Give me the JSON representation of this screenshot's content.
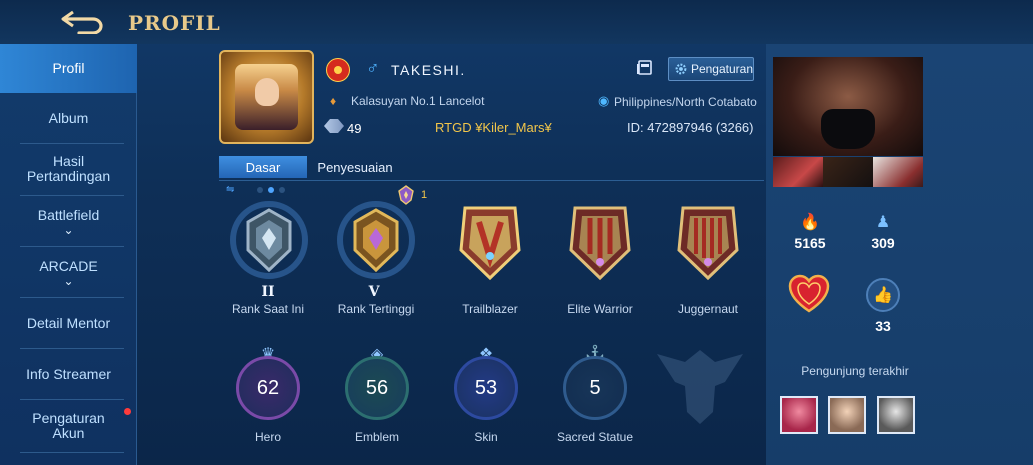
{
  "header": {
    "title": "PROFIL"
  },
  "sidebar": {
    "items": [
      {
        "label": "Profil"
      },
      {
        "label": "Album"
      },
      {
        "label": "Hasil Pertandingan"
      },
      {
        "label": "Battlefield"
      },
      {
        "label": "ARCADE"
      },
      {
        "label": "Detail Mentor"
      },
      {
        "label": "Info Streamer"
      },
      {
        "label": "Pengaturan Akun"
      }
    ]
  },
  "profile": {
    "name": "TAKESHI.",
    "title": "Kalasuyan No.1 Lancelot",
    "level": "49",
    "squad": "RTGD ¥Kiler_Mars¥",
    "location": "Philippines/North Cotabato",
    "id": "ID: 472897946 (3266)",
    "settings_label": "Pengaturan",
    "gender_icon": "male-icon",
    "flag_icon": "north-macedonia-flag-icon"
  },
  "tabs": [
    {
      "label": "Dasar"
    },
    {
      "label": "Penyesuaian"
    }
  ],
  "season_badge_count": "1",
  "medals": [
    {
      "label": "Rank Saat Ini",
      "roman": "II",
      "color": "#9fb4c8",
      "icon": "current-rank-medal-icon"
    },
    {
      "label": "Rank Tertinggi",
      "roman": "V",
      "color": "#e1b85a",
      "icon": "highest-rank-medal-icon"
    },
    {
      "label": "Trailblazer",
      "color": "#f0cf7a",
      "icon": "trailblazer-badge-icon"
    },
    {
      "label": "Elite Warrior",
      "color": "#e0bf7a",
      "icon": "elite-warrior-badge-icon"
    },
    {
      "label": "Juggernaut",
      "color": "#e0bf7a",
      "icon": "juggernaut-badge-icon"
    }
  ],
  "stats": [
    {
      "label": "Hero",
      "value": "62",
      "ring": "#7a4aa8",
      "icon": "hero-icon"
    },
    {
      "label": "Emblem",
      "value": "56",
      "ring": "#2c6f70",
      "icon": "emblem-icon"
    },
    {
      "label": "Skin",
      "value": "53",
      "ring": "#2d4aa0",
      "icon": "skin-icon"
    },
    {
      "label": "Sacred Statue",
      "value": "5",
      "ring": "#2f5b8e",
      "icon": "sacred-statue-icon"
    }
  ],
  "right_panel": {
    "popularity": "5165",
    "followers": "309",
    "likes": "33",
    "visitors_title": "Pengunjung terakhir"
  },
  "colors": {
    "accent": "#2f86d6",
    "gold": "#e8c98a",
    "squad": "#f2c64a"
  }
}
